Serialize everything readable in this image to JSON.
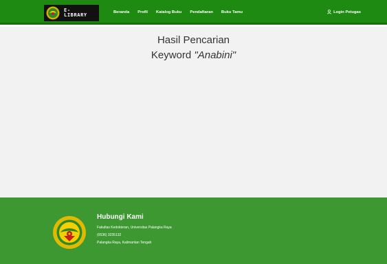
{
  "navbar": {
    "brand_text": "E-\nLIBRARY",
    "links": [
      "Beranda",
      "Profil",
      "Katalog Buku",
      "Pendaftaran",
      "Buku Tamu"
    ],
    "login_label": "Login Petugas",
    "brand_color": "#1f8a12"
  },
  "main": {
    "title": "Hasil Pencarian",
    "keyword_prefix": "Keyword",
    "keyword": "\"Anabini\""
  },
  "footer": {
    "heading": "Hubungi Kami",
    "lines": [
      "Fakultas Kedokteran, Universitas Palangka Raya",
      "(0536) 3235132",
      "Palangka Raya, Kalimantan Tengah"
    ],
    "background_color": "#3d9832"
  }
}
